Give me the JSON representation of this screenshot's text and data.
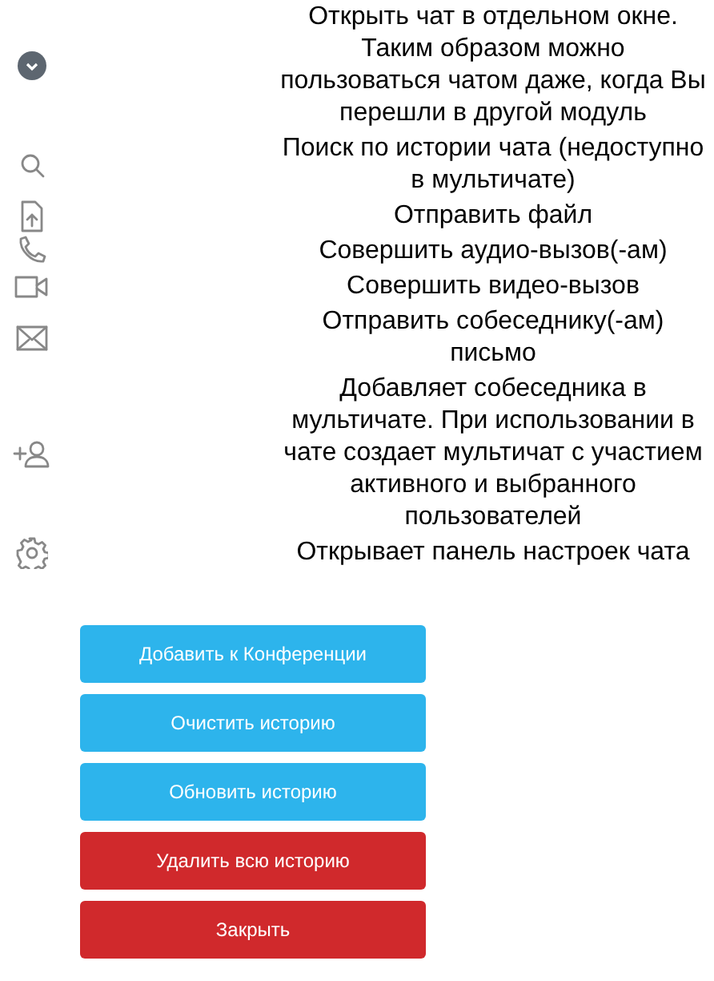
{
  "features": [
    {
      "text": "Открыть чат в отдельном окне. Таким образом можно пользоваться чатом даже, когда Вы перешли в другой модуль"
    },
    {
      "text": "Поиск по истории чата (недоступно в мультичате)"
    },
    {
      "text": "Отправить файл"
    },
    {
      "text": "Совершить аудио-вызов(-ам)"
    },
    {
      "text": "Совершить видео-вызов"
    },
    {
      "text": "Отправить собеседнику(-ам) письмо"
    },
    {
      "text": "Добавляет собеседника в мультичате. При использовании в чате создает мультичат с участием активного и выбранного пользователей"
    },
    {
      "text": "Открывает панель настроек чата"
    }
  ],
  "buttons": [
    {
      "label": "Добавить к Конференции",
      "kind": "primary"
    },
    {
      "label": "Очистить историю",
      "kind": "primary"
    },
    {
      "label": "Обновить историю",
      "kind": "primary"
    },
    {
      "label": "Удалить всю историю",
      "kind": "danger"
    },
    {
      "label": "Закрыть",
      "kind": "danger"
    }
  ]
}
